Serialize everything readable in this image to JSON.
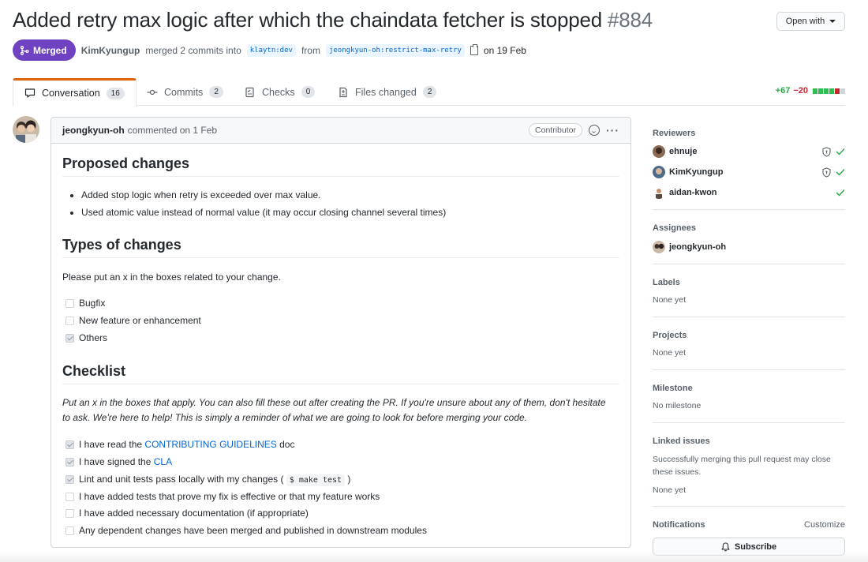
{
  "header": {
    "title": "Added retry max logic after which the chaindata fetcher is stopped",
    "number": "#884",
    "open_with": "Open with"
  },
  "meta": {
    "status": "Merged",
    "author": "KimKyungup",
    "action": "merged 2 commits into",
    "base_branch": "klaytn:dev",
    "from": "from",
    "head_branch": "jeongkyun-oh:restrict-max-retry",
    "date": "on 19 Feb",
    "status_color": "#6f42c1"
  },
  "tabs": [
    {
      "label": "Conversation",
      "count": "16",
      "icon": "comment-icon"
    },
    {
      "label": "Commits",
      "count": "2",
      "icon": "commit-icon"
    },
    {
      "label": "Checks",
      "count": "0",
      "icon": "checklist-icon"
    },
    {
      "label": "Files changed",
      "count": "2",
      "icon": "file-diff-icon"
    }
  ],
  "diffstat": {
    "additions": "+67",
    "deletions": "−20"
  },
  "comment": {
    "author": "jeongkyun-oh",
    "action": "commented on 1 Feb",
    "role": "Contributor",
    "sections": {
      "proposed": {
        "heading": "Proposed changes",
        "items": [
          "Added stop logic when retry is exceeded over max value.",
          "Used atomic value instead of normal value (it may occur closing channel several times)"
        ]
      },
      "types": {
        "heading": "Types of changes",
        "intro": "Please put an x in the boxes related to your change.",
        "options": [
          {
            "label": "Bugfix",
            "checked": false
          },
          {
            "label": "New feature or enhancement",
            "checked": false
          },
          {
            "label": "Others",
            "checked": true
          }
        ]
      },
      "checklist": {
        "heading": "Checklist",
        "intro": "Put an x in the boxes that apply. You can also fill these out after creating the PR. If you're unsure about any of them, don't hesitate to ask. We're here to help! This is simply a reminder of what we are going to look for before merging your code.",
        "item1_pre": "I have read the",
        "item1_link": "CONTRIBUTING GUIDELINES",
        "item1_post": "doc",
        "item2_pre": "I have signed the",
        "item2_link": "CLA",
        "item3_pre": "Lint and unit tests pass locally with my changes (",
        "item3_code": "$ make test",
        "item3_post": ")",
        "item4": "I have added tests that prove my fix is effective or that my feature works",
        "item5": "I have added necessary documentation (if appropriate)",
        "item6": "Any dependent changes have been merged and published in downstream modules"
      }
    }
  },
  "sidebar": {
    "reviewers_title": "Reviewers",
    "reviewers": [
      {
        "name": "ehnuje"
      },
      {
        "name": "KimKyungup"
      },
      {
        "name": "aidan-kwon"
      }
    ],
    "assignees_title": "Assignees",
    "assignee": "jeongkyun-oh",
    "labels_title": "Labels",
    "labels_value": "None yet",
    "projects_title": "Projects",
    "projects_value": "None yet",
    "milestone_title": "Milestone",
    "milestone_value": "No milestone",
    "linked_title": "Linked issues",
    "linked_desc": "Successfully merging this pull request may close these issues.",
    "linked_value": "None yet",
    "notifications_title": "Notifications",
    "customize": "Customize",
    "subscribe": "Subscribe"
  }
}
